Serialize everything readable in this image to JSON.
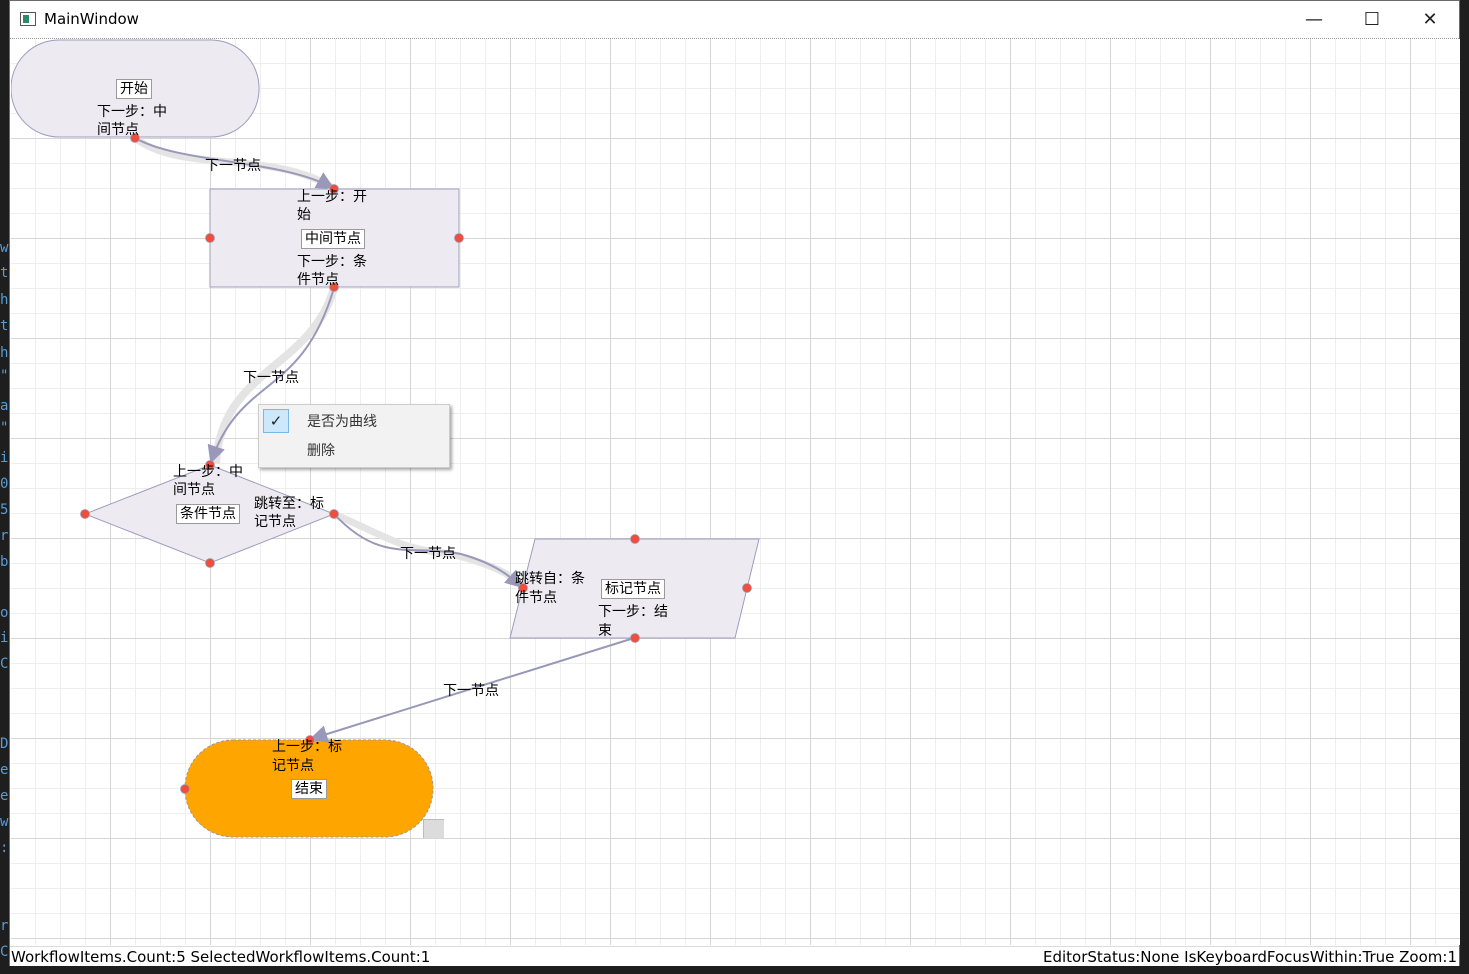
{
  "window": {
    "title": "MainWindow",
    "minimize_glyph": "—",
    "maximize_glyph": "☐",
    "close_glyph": "✕"
  },
  "nodes": {
    "start": {
      "name": "开始",
      "next_line1": "下一步：中",
      "next_line2": "间节点"
    },
    "middle": {
      "name": "中间节点",
      "prev_line1": "上一步：开",
      "prev_line2": "始",
      "next_line1": "下一步：条",
      "next_line2": "件节点"
    },
    "condition": {
      "name": "条件节点",
      "prev_line1": "上一步：中",
      "prev_line2": "间节点",
      "jump_line1": "跳转至：标",
      "jump_line2": "记节点"
    },
    "mark": {
      "name": "标记节点",
      "from_line1": "跳转自：条",
      "from_line2": "件节点",
      "next_line1": "下一步：结",
      "next_line2": "束"
    },
    "end": {
      "name": "结束",
      "prev_line1": "上一步：标",
      "prev_line2": "记节点"
    }
  },
  "edge_labels": {
    "e1": "下一节点",
    "e2": "下一节点",
    "e3": "下一节点",
    "e4": "下一节点"
  },
  "context_menu": {
    "curve_label": "是否为曲线",
    "curve_checked": true,
    "delete_label": "删除"
  },
  "status": {
    "left": "WorkflowItems.Count:5 SelectedWorkflowItems.Count:1",
    "right": "EditorStatus:None IsKeyboardFocusWithin:True Zoom:1"
  },
  "colors": {
    "node_fill": "#edebf1",
    "node_stroke": "#9e9cbd",
    "end_fill": "#ffa500",
    "connector": "#ef4e3a",
    "edge": "#9a98b8"
  }
}
